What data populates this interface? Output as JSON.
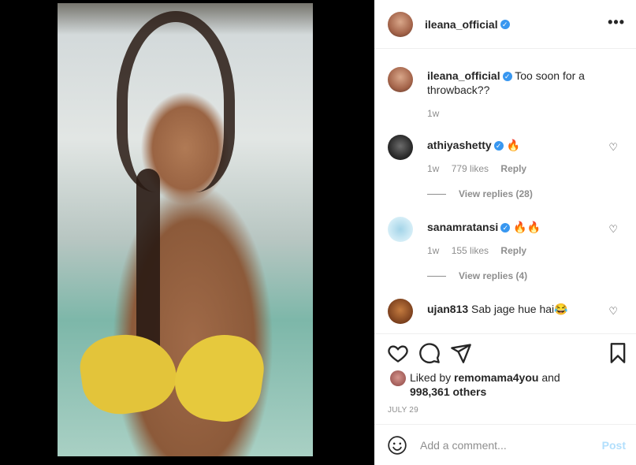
{
  "header": {
    "username": "ileana_official",
    "verified": true,
    "more_label": "•••"
  },
  "caption": {
    "username": "ileana_official",
    "text": "Too soon for a throwback??",
    "time": "1w"
  },
  "comments": [
    {
      "username": "athiyashetty",
      "verified": true,
      "text": "🔥",
      "time": "1w",
      "likes": "779 likes",
      "reply_label": "Reply",
      "view_replies": "View replies (28)"
    },
    {
      "username": "sanamratansi",
      "verified": true,
      "text": "🔥🔥",
      "time": "1w",
      "likes": "155 likes",
      "reply_label": "Reply",
      "view_replies": "View replies (4)"
    },
    {
      "username": "ujan813",
      "verified": false,
      "text": "Sab jage hue hai😂"
    }
  ],
  "likes": {
    "prefix": "Liked by",
    "liker": "remomama4you",
    "conjunction": "and",
    "others": "998,361 others"
  },
  "date": "JULY 29",
  "add_comment": {
    "placeholder": "Add a comment...",
    "post_label": "Post"
  },
  "icons": {
    "like": "heart-icon",
    "comment": "comment-icon",
    "share": "share-icon",
    "save": "bookmark-icon",
    "emoji": "emoji-icon"
  },
  "colors": {
    "verified": "#3897f0",
    "post_disabled": "#b2dffc",
    "muted_text": "#8e8e8e"
  }
}
